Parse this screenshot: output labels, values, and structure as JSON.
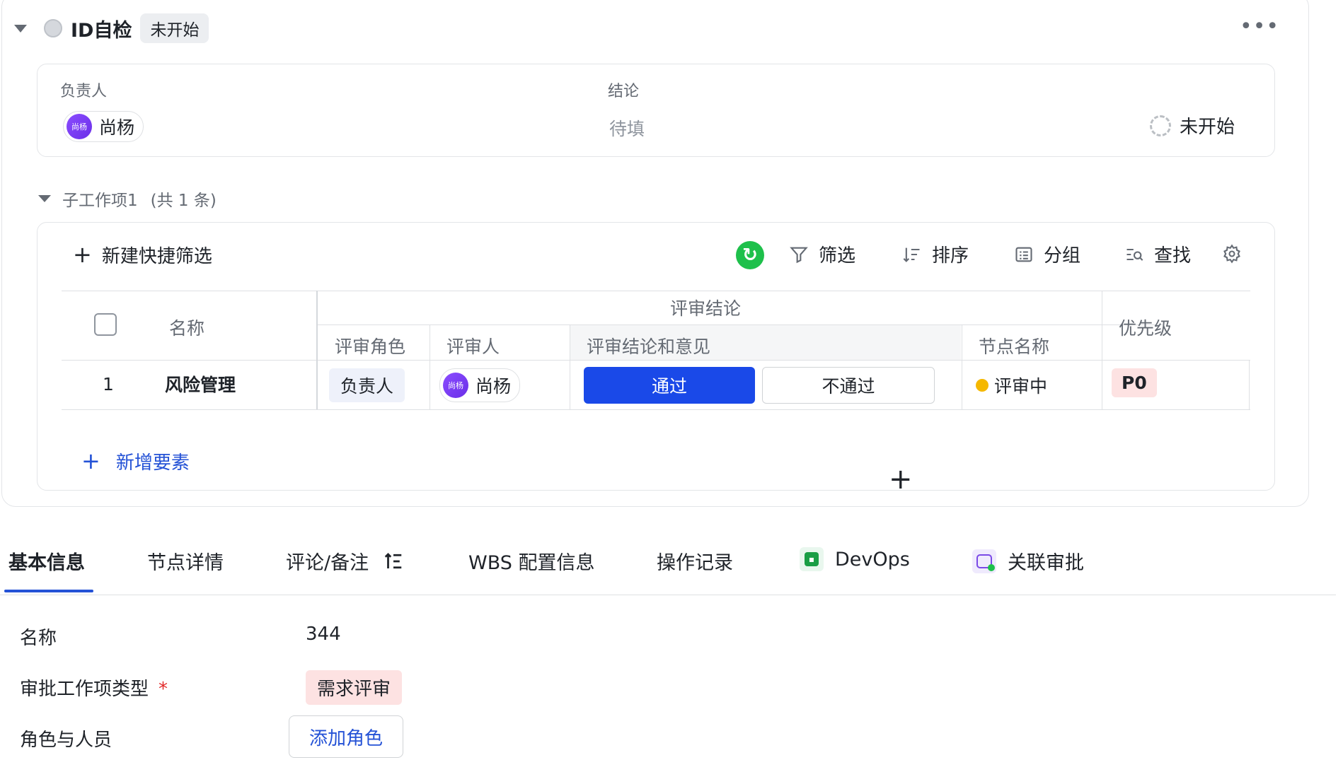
{
  "header": {
    "title": "ID自检",
    "status": "未开始"
  },
  "info": {
    "owner_label": "负责人",
    "conclusion_label": "结论",
    "owner": {
      "avatar_text": "尚杨",
      "name": "尚杨"
    },
    "conclusion_value": "待填",
    "state": "未开始"
  },
  "subitems": {
    "title": "子工作项1",
    "count": "(共 1 条)"
  },
  "toolbar": {
    "new_filter": "新建快捷筛选",
    "filter": "筛选",
    "sort": "排序",
    "group": "分组",
    "search": "查找"
  },
  "table": {
    "col_name": "名称",
    "group_review": "评审结论",
    "col_role": "评审角色",
    "col_reviewer": "评审人",
    "col_opinion": "评审结论和意见",
    "col_node": "节点名称",
    "col_priority": "优先级",
    "rows": [
      {
        "index": "1",
        "name": "风险管理",
        "role": "负责人",
        "reviewer_avatar": "尚杨",
        "reviewer": "尚杨",
        "pass": "通过",
        "fail": "不通过",
        "node": "评审中",
        "priority": "P0"
      }
    ],
    "add_element": "新增要素"
  },
  "tabs": [
    {
      "label": "基本信息"
    },
    {
      "label": "节点详情"
    },
    {
      "label": "评论/备注"
    },
    {
      "label": "WBS 配置信息"
    },
    {
      "label": "操作记录"
    },
    {
      "label": "DevOps"
    },
    {
      "label": "关联审批"
    }
  ],
  "form": {
    "name_label": "名称",
    "name_value": "344",
    "type_label": "审批工作项类型",
    "type_value": "需求评审",
    "roles_label": "角色与人员",
    "add_role": "添加角色"
  },
  "colors": {
    "accent": "#2452d6",
    "pass_button": "#1a49e8",
    "refresh": "#1ec04b",
    "status_yellow": "#f5b800",
    "priority_bg": "#fde2e2"
  }
}
